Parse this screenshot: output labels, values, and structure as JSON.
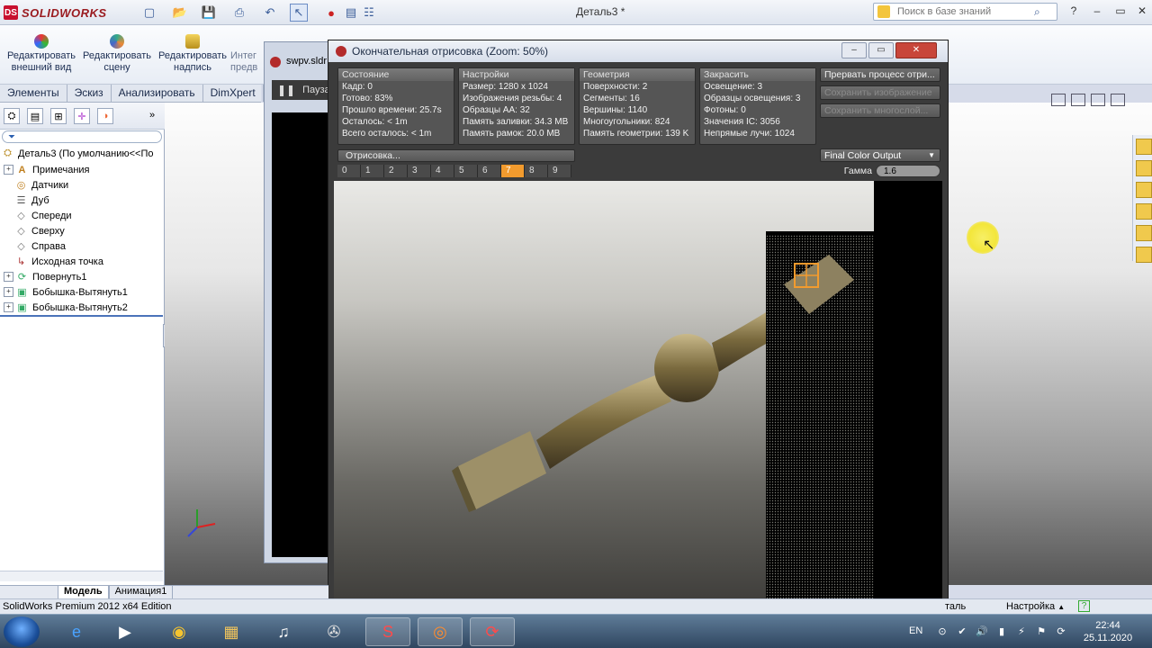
{
  "app": {
    "brand": "SOLIDWORKS",
    "document_title": "Деталь3 *",
    "search_placeholder": "Поиск в базе знаний"
  },
  "ribbon": {
    "buttons": [
      {
        "label1": "Редактировать",
        "label2": "внешний вид"
      },
      {
        "label1": "Редактировать",
        "label2": "сцену"
      },
      {
        "label1": "Редактировать",
        "label2": "надпись"
      },
      {
        "label1": "Интег",
        "label2": "предв"
      }
    ]
  },
  "command_tabs": [
    "Элементы",
    "Эскиз",
    "Анализировать",
    "DimXpert"
  ],
  "feature_tree": {
    "root": "Деталь3  (По умолчанию<<По",
    "items": [
      {
        "label": "Примечания",
        "expand": "+",
        "icon": "A"
      },
      {
        "label": "Датчики",
        "expand": "",
        "icon": "◎"
      },
      {
        "label": "Дуб",
        "expand": "",
        "icon": "☰"
      },
      {
        "label": "Спереди",
        "expand": "",
        "icon": "◇"
      },
      {
        "label": "Сверху",
        "expand": "",
        "icon": "◇"
      },
      {
        "label": "Справа",
        "expand": "",
        "icon": "◇"
      },
      {
        "label": "Исходная точка",
        "expand": "",
        "icon": "↳"
      },
      {
        "label": "Повернуть1",
        "expand": "+",
        "icon": "⟳"
      },
      {
        "label": "Бобышка-Вытянуть1",
        "expand": "+",
        "icon": "▣"
      },
      {
        "label": "Бобышка-Вытянуть2",
        "expand": "+",
        "icon": "▣"
      }
    ]
  },
  "swpv_window": {
    "title": "swpv.sldr",
    "pause_label": "Пауза"
  },
  "render_window": {
    "title": "Окончательная отрисовка (Zoom: 50%)",
    "panels": {
      "state": {
        "header": "Состояние",
        "rows": [
          "Кадр: 0",
          "Готово: 83%",
          "Прошло времени: 25.7s",
          "Осталось: < 1m",
          "Всего осталось: < 1m"
        ]
      },
      "settings": {
        "header": "Настройки",
        "rows": [
          "Размер: 1280 x 1024",
          "Изображения резьбы: 4",
          "Образцы АА: 32",
          "Память заливки: 34.3 MB",
          "Память рамок: 20.0 MB"
        ]
      },
      "geometry": {
        "header": "Геометрия",
        "rows": [
          "Поверхности: 2",
          "Сегменты: 16",
          "Вершины: 1140",
          "Многоугольники: 824",
          "Память геометрии: 139 K"
        ]
      },
      "shading": {
        "header": "Закрасить",
        "rows": [
          "Освещение: 3",
          "Образцы освещения: 3",
          "Фотоны: 0",
          "Значения IC: 3056",
          "Непрямые лучи: 1024"
        ]
      }
    },
    "actions": {
      "abort": "Прервать процесс отри...",
      "save_image": "Сохранить изображение",
      "save_layers": "Сохранить многослой..."
    },
    "progress_label": "Отрисовка...",
    "passes": [
      "0",
      "1",
      "2",
      "3",
      "4",
      "5",
      "6",
      "7",
      "8",
      "9"
    ],
    "active_pass": "7",
    "output_select": "Final Color Output",
    "gamma_label": "Гамма",
    "gamma_value": "1.6"
  },
  "bottom_tabs": {
    "model": "Модель",
    "animation": "Анимация1"
  },
  "status_bar": {
    "edition": "SolidWorks Premium 2012 x64 Edition",
    "part_fragment": "таль",
    "settings": "Настройка"
  },
  "taskbar": {
    "lang": "EN",
    "time": "22:44",
    "date": "25.11.2020"
  },
  "colors": {
    "accent_orange": "#f29b2e",
    "brand_red": "#c8102e",
    "panel_gray": "#555555"
  }
}
